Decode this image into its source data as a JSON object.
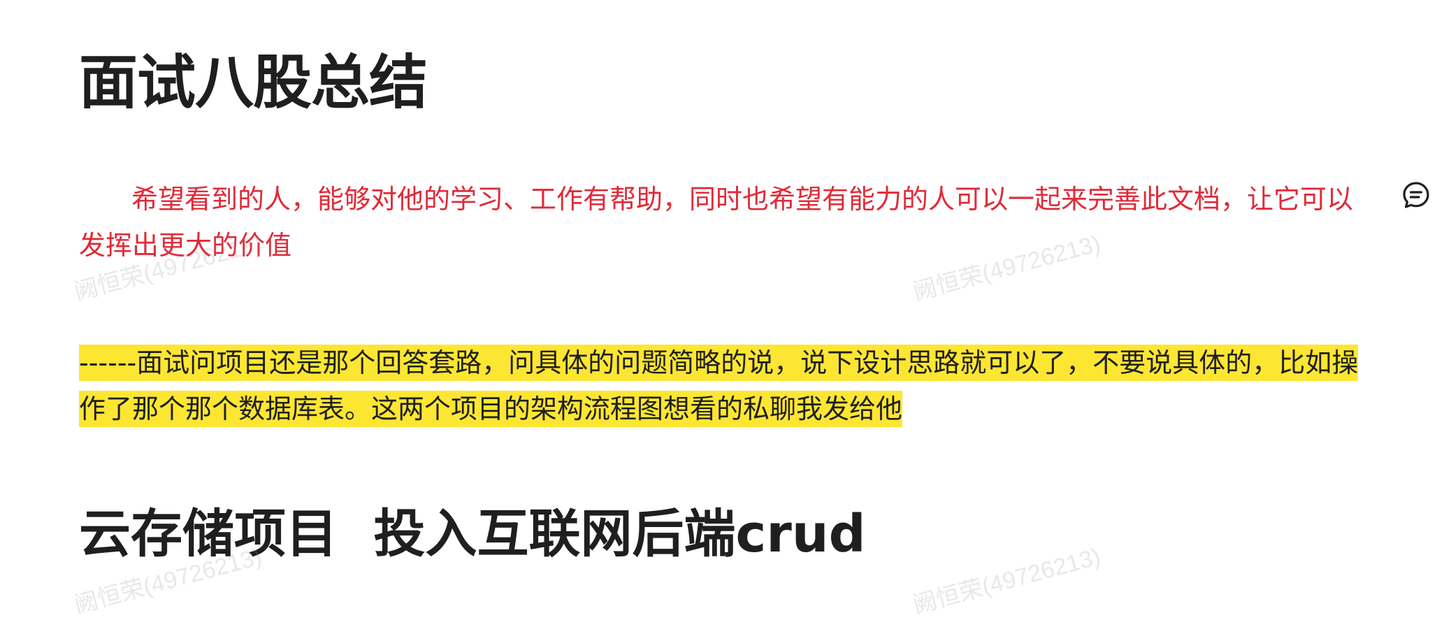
{
  "document": {
    "title": "面试八股总结",
    "intro": "希望看到的人，能够对他的学习、工作有帮助，同时也希望有能力的人可以一起来完善此文档，让它可以发挥出更大的价值",
    "note": "------面试问项目还是那个回答套路，问具体的问题简略的说，说下设计思路就可以了，不要说具体的，比如操作了那个那个数据库表。这两个项目的架构流程图想看的私聊我发给他",
    "section_title": "云存储项目  投入互联网后端crud"
  },
  "watermarks": [
    "阙恒荣(49726213)",
    "阙恒荣(49726213)",
    "阙恒荣(49726213)",
    "阙恒荣(49726213)"
  ],
  "icons": {
    "comment": "comment-icon"
  },
  "colors": {
    "intro_text": "#e02a38",
    "highlight": "#fde632",
    "body_text": "#1f1f1f"
  }
}
